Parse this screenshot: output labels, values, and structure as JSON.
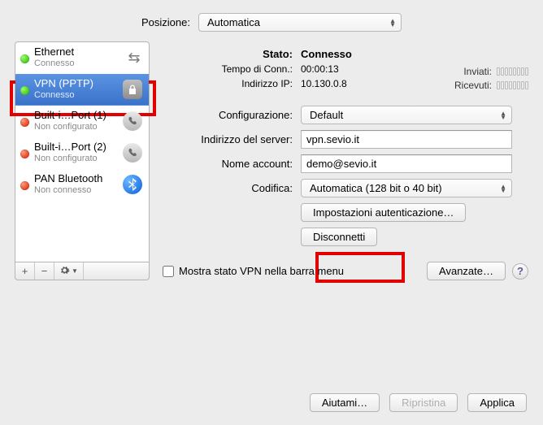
{
  "position": {
    "label": "Posizione:",
    "value": "Automatica"
  },
  "network_list": [
    {
      "name": "Ethernet",
      "status": "Connesso",
      "dot": "green",
      "icon": "eth"
    },
    {
      "name": "VPN (PPTP)",
      "status": "Connesso",
      "dot": "green",
      "icon": "lock",
      "selected": true
    },
    {
      "name": "Built-i…Port (1)",
      "status": "Non configurato",
      "dot": "red",
      "icon": "phone"
    },
    {
      "name": "Built-i…Port (2)",
      "status": "Non configurato",
      "dot": "red",
      "icon": "phone"
    },
    {
      "name": "PAN Bluetooth",
      "status": "Non connesso",
      "dot": "red",
      "icon": "bt"
    }
  ],
  "status": {
    "label": "Stato:",
    "value": "Connesso",
    "conn_time_label": "Tempo di Conn.:",
    "conn_time": "00:00:13",
    "ip_label": "Indirizzo IP:",
    "ip": "10.130.0.8",
    "sent_label": "Inviati:",
    "recv_label": "Ricevuti:"
  },
  "config": {
    "label": "Configurazione:",
    "value": "Default"
  },
  "server": {
    "label": "Indirizzo del server:",
    "value": "vpn.sevio.it"
  },
  "account": {
    "label": "Nome account:",
    "value": "demo@sevio.it"
  },
  "encoding": {
    "label": "Codifica:",
    "value": "Automatica (128 bit o 40 bit)"
  },
  "buttons": {
    "auth_settings": "Impostazioni autenticazione…",
    "disconnect": "Disconnetti",
    "advanced": "Avanzate…",
    "help_me": "Aiutami…",
    "revert": "Ripristina",
    "apply": "Applica"
  },
  "show_vpn_menu": {
    "label": "Mostra stato VPN nella barra menu",
    "checked": false
  },
  "toolbar": {
    "plus": "+",
    "minus": "−",
    "gear": "✱"
  }
}
